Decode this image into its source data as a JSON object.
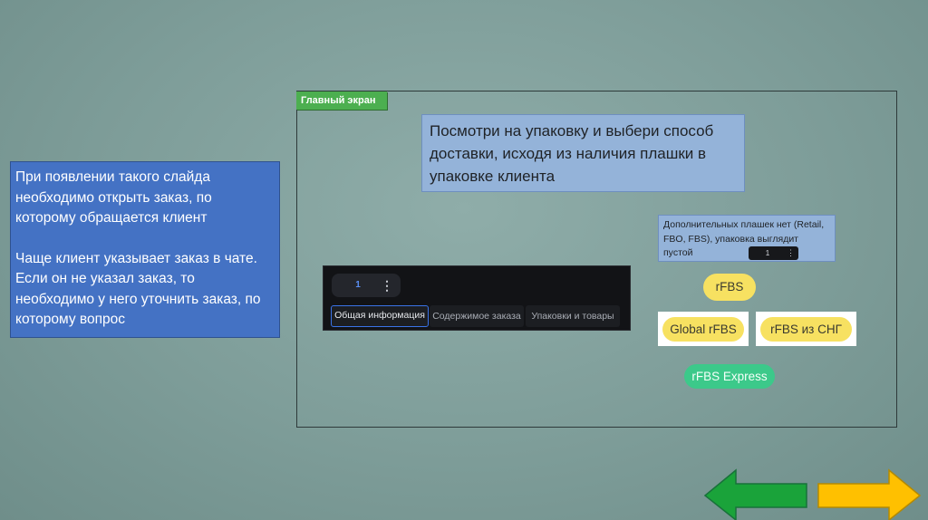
{
  "left_note": {
    "paragraph1": "При появлении такого слайда необходимо открыть заказ, по которому обращается клиент",
    "paragraph2": "Чаще клиент указывает заказ в чате. Если он не указал заказ, то необходимо у него уточнить заказ, по которому вопрос"
  },
  "frame": {
    "tag": "Главный экран"
  },
  "instruction": "Посмотри на упаковку и выбери способ доставки, исходя из наличия плашки в упаковке клиента",
  "app_screenshot": {
    "order_number": "1",
    "menu_icon": "kebab-menu-icon",
    "tabs": [
      {
        "label": "Общая информация",
        "active": true
      },
      {
        "label": "Содержимое заказа",
        "active": false
      },
      {
        "label": "Упаковки и товары",
        "active": false
      }
    ]
  },
  "extra_badges_note": {
    "text": "Дополнительных плашек нет (Retail, FBO, FBS), упаковка выглядит пустой",
    "order_number": "1"
  },
  "badges": {
    "rfbs": "rFBS",
    "global_rfbs": "Global rFBS",
    "rfbs_cis": "rFBS из СНГ",
    "rfbs_express": "rFBS Express"
  },
  "navigation": {
    "back_icon": "arrow-left-icon",
    "forward_icon": "arrow-right-icon"
  },
  "colors": {
    "background": "#7e9d99",
    "note_blue": "#4472c4",
    "tag_green": "#4caf50",
    "badge_yellow": "#f7e161",
    "badge_green": "#3cc98a",
    "arrow_green": "#1aa33a",
    "arrow_yellow": "#ffc000"
  }
}
